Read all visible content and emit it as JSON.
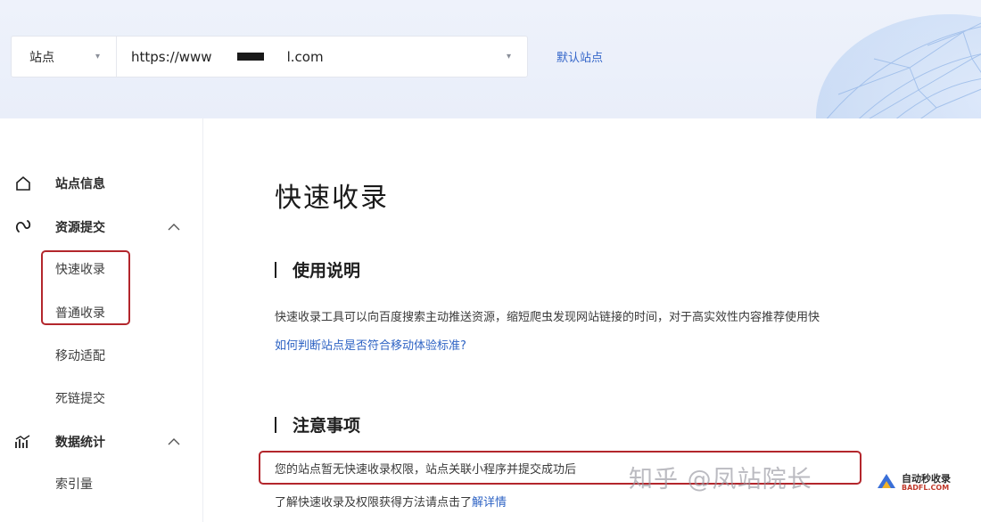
{
  "header": {
    "site_select": {
      "label": "站点"
    },
    "url_select": {
      "prefix": "https://www",
      "suffix": "l.com"
    },
    "default_site_link": "默认站点"
  },
  "sidebar": {
    "groups": [
      {
        "label": "站点信息",
        "icon": "home-icon"
      },
      {
        "label": "资源提交",
        "icon": "link-icon",
        "expanded": true,
        "items": [
          "快速收录",
          "普通收录",
          "移动适配",
          "死链提交"
        ]
      },
      {
        "label": "数据统计",
        "icon": "chart-icon",
        "expanded": true,
        "items": [
          "索引量"
        ]
      }
    ]
  },
  "main": {
    "page_title": "快速收录",
    "usage": {
      "title": "使用说明",
      "text": "快速收录工具可以向百度搜索主动推送资源，缩短爬虫发现网站链接的时间，对于高实效性内容推荐使用快",
      "link": "如何判断站点是否符合移动体验标准?"
    },
    "notice": {
      "title": "注意事项",
      "text": "您的站点暂无快速收录权限，站点关联小程序并提交成功后",
      "text2_prefix": "了解快速收录及权限获得方法请点击了",
      "text2_link": "解详情"
    }
  },
  "watermark": {
    "text": "知乎 @凤站院长",
    "logo_main": "自动秒收录",
    "logo_sub": "BADFL.COM"
  },
  "colors": {
    "accent_link": "#2e63c4",
    "highlight": "#b3262c",
    "header_bg": "#eef2fb"
  }
}
